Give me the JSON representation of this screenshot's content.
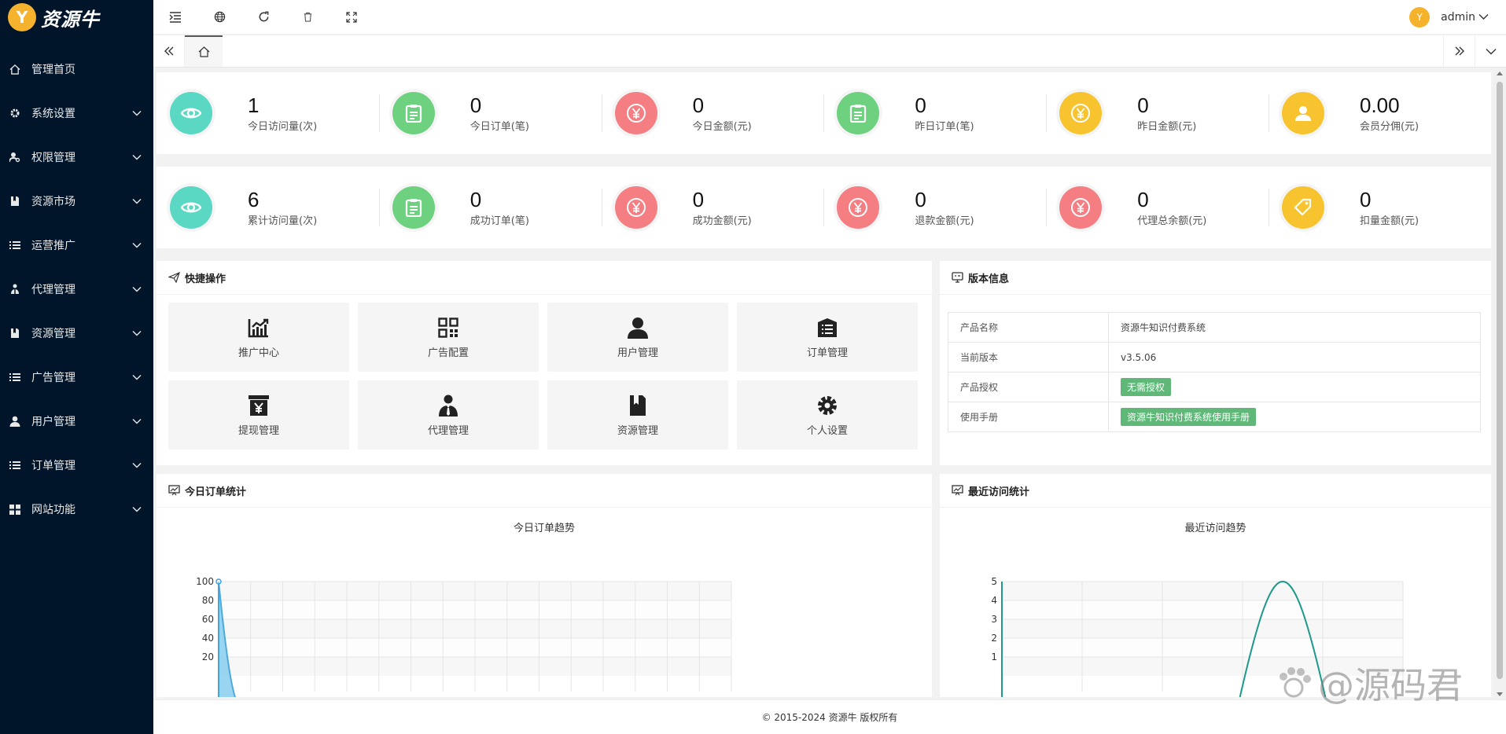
{
  "brand": {
    "name": "资源牛",
    "logo_glyph": "Y"
  },
  "sidebar": {
    "items": [
      {
        "label": "管理首页",
        "icon": "home-icon",
        "has_children": false
      },
      {
        "label": "系统设置",
        "icon": "gear-icon",
        "has_children": true
      },
      {
        "label": "权限管理",
        "icon": "user-key-icon",
        "has_children": true
      },
      {
        "label": "资源市场",
        "icon": "book-icon",
        "has_children": true
      },
      {
        "label": "运营推广",
        "icon": "list-icon",
        "has_children": true
      },
      {
        "label": "代理管理",
        "icon": "sitemap-icon",
        "has_children": true
      },
      {
        "label": "资源管理",
        "icon": "book-icon",
        "has_children": true
      },
      {
        "label": "广告管理",
        "icon": "list-icon",
        "has_children": true
      },
      {
        "label": "用户管理",
        "icon": "user-icon",
        "has_children": true
      },
      {
        "label": "订单管理",
        "icon": "list-icon",
        "has_children": true
      },
      {
        "label": "网站功能",
        "icon": "grid-icon",
        "has_children": true
      }
    ]
  },
  "header": {
    "user": "admin",
    "avatar_glyph": "Y"
  },
  "stats_row1": [
    {
      "value": "1",
      "label": "今日访问量(次)",
      "icon": "eye-icon",
      "color": "#5ad8c4"
    },
    {
      "value": "0",
      "label": "今日订单(笔)",
      "icon": "clipboard-icon",
      "color": "#6dd17f"
    },
    {
      "value": "0",
      "label": "今日金额(元)",
      "icon": "yen-icon",
      "color": "#f57e83"
    },
    {
      "value": "0",
      "label": "昨日订单(笔)",
      "icon": "clipboard-icon",
      "color": "#6dd17f"
    },
    {
      "value": "0",
      "label": "昨日金额(元)",
      "icon": "yen-icon",
      "color": "#f7c430"
    },
    {
      "value": "0.00",
      "label": "会员分佣(元)",
      "icon": "person-icon",
      "color": "#f7c430"
    }
  ],
  "stats_row2": [
    {
      "value": "6",
      "label": "累计访问量(次)",
      "icon": "eye-icon",
      "color": "#5ad8c4"
    },
    {
      "value": "0",
      "label": "成功订单(笔)",
      "icon": "clipboard-icon",
      "color": "#6dd17f"
    },
    {
      "value": "0",
      "label": "成功金额(元)",
      "icon": "yen-icon",
      "color": "#f57e83"
    },
    {
      "value": "0",
      "label": "退款金额(元)",
      "icon": "yen-icon",
      "color": "#f57e83"
    },
    {
      "value": "0",
      "label": "代理总余额(元)",
      "icon": "yen-icon",
      "color": "#f57e83"
    },
    {
      "value": "0",
      "label": "扣量金额(元)",
      "icon": "tag-icon",
      "color": "#f7c430"
    }
  ],
  "quick": {
    "title": "快捷操作",
    "items": [
      {
        "label": "推广中心",
        "icon": "trend-chart-icon"
      },
      {
        "label": "广告配置",
        "icon": "qrcode-icon"
      },
      {
        "label": "用户管理",
        "icon": "user-icon"
      },
      {
        "label": "订单管理",
        "icon": "list-box-icon"
      },
      {
        "label": "提现管理",
        "icon": "withdraw-icon"
      },
      {
        "label": "代理管理",
        "icon": "agent-icon"
      },
      {
        "label": "资源管理",
        "icon": "book-icon"
      },
      {
        "label": "个人设置",
        "icon": "gear-icon"
      }
    ]
  },
  "version": {
    "title": "版本信息",
    "rows": [
      {
        "key": "产品名称",
        "value": "资源牛知识付费系统",
        "type": "text"
      },
      {
        "key": "当前版本",
        "value": "v3.5.06",
        "type": "text"
      },
      {
        "key": "产品授权",
        "value": "无需授权",
        "type": "badge",
        "color": "#5fb878"
      },
      {
        "key": "使用手册",
        "value": "资源牛知识付费系统使用手册",
        "type": "badge",
        "color": "#5fb878"
      }
    ]
  },
  "order_chart": {
    "panel_title": "今日订单统计",
    "chart_data": {
      "type": "area",
      "title": "今日订单趋势",
      "ylim": [
        0,
        100
      ],
      "yticks": [
        20,
        40,
        60,
        80,
        100
      ],
      "points": [
        {
          "x": 0,
          "y": 100
        }
      ],
      "color": "#3ca1d9",
      "grid": true
    }
  },
  "visit_chart": {
    "panel_title": "最近访问统计",
    "chart_data": {
      "type": "line",
      "title": "最近访问趋势",
      "ylim": [
        0,
        5
      ],
      "yticks": [
        1,
        2,
        3,
        4,
        5
      ],
      "peak": {
        "x": 3.5,
        "y": 5
      },
      "color": "#1f9a8a",
      "grid": true
    }
  },
  "footer": {
    "text": "© 2015-2024 资源牛 版权所有"
  },
  "watermark": {
    "text": "@源码君"
  }
}
